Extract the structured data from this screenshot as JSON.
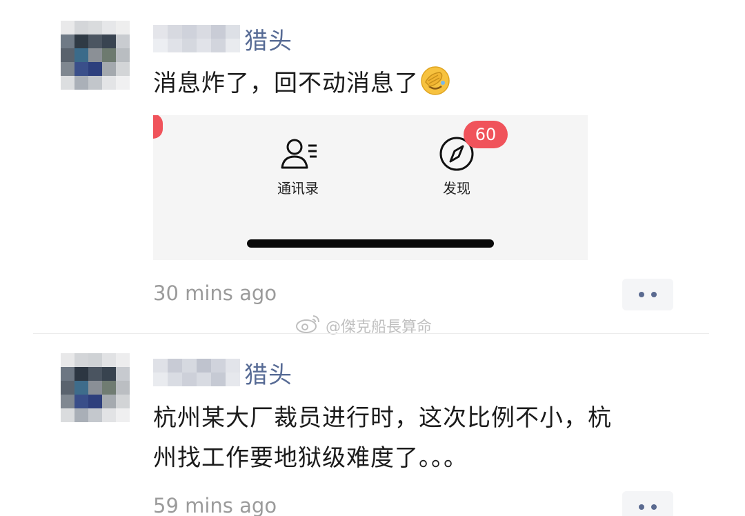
{
  "posts": [
    {
      "name_suffix": "猎头",
      "message": "消息炸了，回不动消息了",
      "emoji": "facepalm-emoji",
      "time": "30 mins ago",
      "attachment": {
        "tabs": [
          {
            "label": "通讯录",
            "icon": "contacts-icon"
          },
          {
            "label": "发现",
            "icon": "compass-icon"
          }
        ],
        "badge": "60"
      }
    },
    {
      "name_suffix": "猎头",
      "message_line1": "杭州某大厂裁员进行时，这次比例不小，杭",
      "message_line2": "州找工作要地狱级难度了。。。",
      "time": "59 mins ago"
    }
  ],
  "watermark": "@傑克船長算命",
  "colors": {
    "name": "#576b95",
    "badge": "#f0535b",
    "time": "#9b9b9b"
  }
}
